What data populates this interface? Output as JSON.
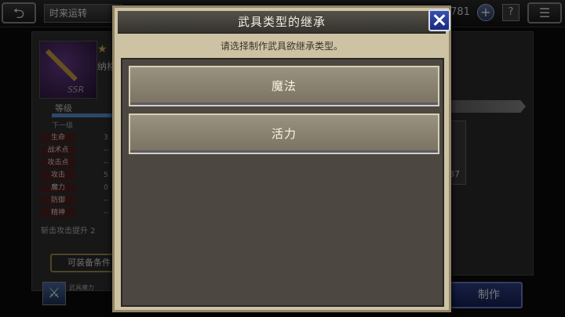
{
  "topbar": {
    "back_icon": "⮌",
    "location_title": "时来运转",
    "currency_value": ",781",
    "plus_icon": "+",
    "help_icon": "?",
    "menu_icon": "☰"
  },
  "background": {
    "weapon_name": "纳格",
    "rank": "SSR",
    "level_label": "等级",
    "next_level_label": "下一级",
    "stats": [
      {
        "name": "生命",
        "value": "3"
      },
      {
        "name": "战术点",
        "value": "--"
      },
      {
        "name": "攻击点",
        "value": "--"
      },
      {
        "name": "攻击",
        "value": "5"
      },
      {
        "name": "魔力",
        "value": "0"
      },
      {
        "name": "防御",
        "value": "--"
      },
      {
        "name": "精神",
        "value": "--"
      }
    ],
    "ability_text": "斩击攻击提升 2",
    "equip_button_label": "可装备条件",
    "bottom_item_label": "武具魔力",
    "material_count": "37",
    "craft_button_label": "制作"
  },
  "dialog": {
    "title": "武具类型的继承",
    "subtitle": "请选择制作武具欲继承类型。",
    "options": [
      "魔法",
      "活力"
    ]
  }
}
